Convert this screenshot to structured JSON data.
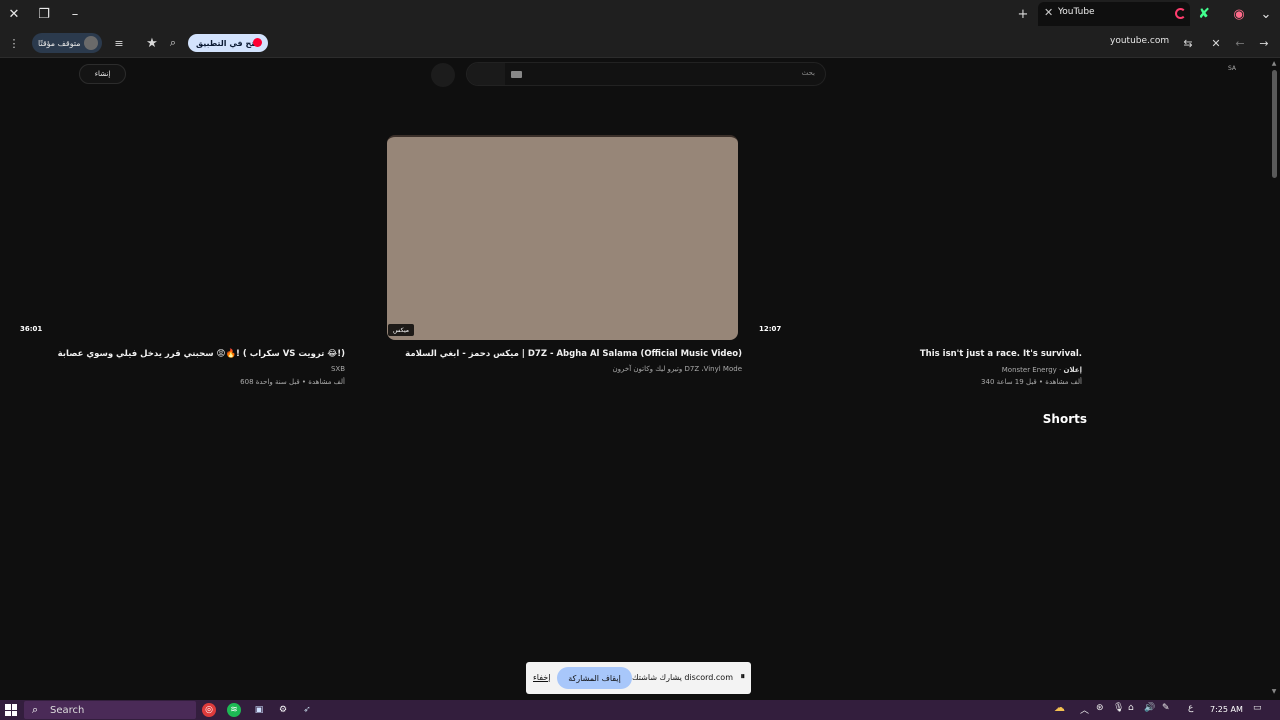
{
  "browser": {
    "tab_title": "YouTube",
    "url": "youtube.com",
    "paused_label": "متوقف مؤقتًا",
    "open_in_app_label": "فتح في التطبيق"
  },
  "youtube": {
    "signin_label": "إنشاء",
    "search_placeholder": "بحث",
    "region": "SA",
    "shorts_heading": "Shorts",
    "videos": [
      {
        "duration": "12:07",
        "title": "This isn't just a race. It's survival.",
        "ad_label": "إعلان",
        "channel": "Monster Energy",
        "stats": "340 ألف مشاهدة • قبل 19 ساعة"
      },
      {
        "badge": "ميكس",
        "title": "ميكس دحمز - ابغي السلامة | D7Z - Abgha Al Salama (Official Music Video)",
        "channel": "وتيرو ليك وكاتون آخرون D7Z ،Vinyl Mode"
      },
      {
        "duration": "36:01",
        "title": "سحبني قرر يدخل فيلي وسوي عصابة 😡🔥! ( سكراب VS ترويت 😂!)",
        "channel": "SXB",
        "stats": "608 ألف مشاهدة • قبل سنة واحدة"
      }
    ]
  },
  "share_bar": {
    "message": "يشارك شاشتك discord.com",
    "stop_label": "إيقاف المشاركة",
    "hide_label": "إخفاء"
  },
  "taskbar": {
    "search_label": "Search",
    "time": "7:25 AM",
    "lang": "ع"
  },
  "colors": {
    "page_bg": "#0f0f0f",
    "thumbnail": "#978678",
    "taskbar": "#331e3d",
    "stop_button": "#a8c7fa"
  }
}
